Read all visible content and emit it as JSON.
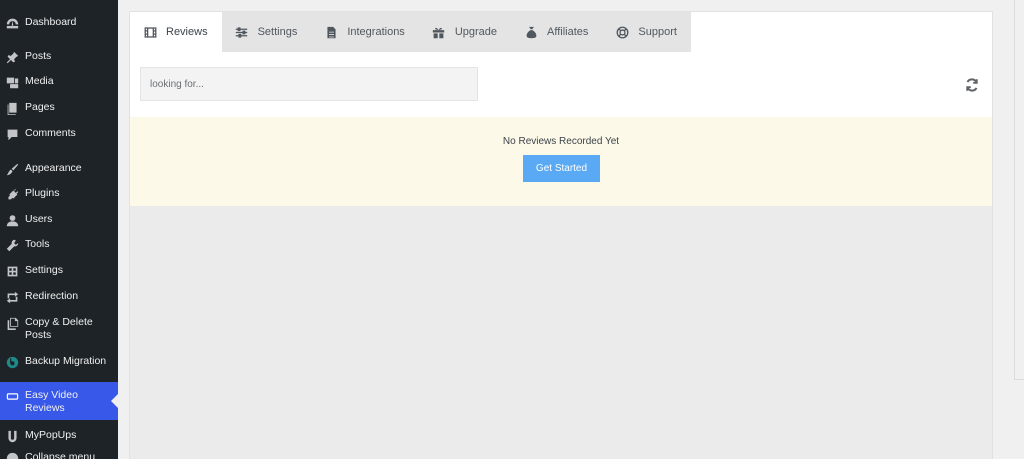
{
  "sidebar": {
    "items": [
      {
        "label": "Dashboard",
        "icon": "dashboard-icon"
      },
      {
        "label": "Posts",
        "icon": "pin-icon"
      },
      {
        "label": "Media",
        "icon": "media-icon"
      },
      {
        "label": "Pages",
        "icon": "pages-icon"
      },
      {
        "label": "Comments",
        "icon": "comment-icon"
      },
      {
        "label": "Appearance",
        "icon": "brush-icon"
      },
      {
        "label": "Plugins",
        "icon": "plug-icon"
      },
      {
        "label": "Users",
        "icon": "user-icon"
      },
      {
        "label": "Tools",
        "icon": "wrench-icon"
      },
      {
        "label": "Settings",
        "icon": "settings-icon"
      },
      {
        "label": "Redirection",
        "icon": "redirect-icon"
      },
      {
        "label": "Copy & Delete Posts",
        "icon": "copy-icon"
      },
      {
        "label": "Backup Migration",
        "icon": "backup-icon"
      },
      {
        "label": "Easy Video Reviews",
        "icon": "video-review-icon"
      },
      {
        "label": "MyPopUps",
        "icon": "popup-icon"
      },
      {
        "label": "Collapse menu",
        "icon": "collapse-icon"
      }
    ],
    "active_label": "Easy Video Reviews"
  },
  "tabs": [
    {
      "label": "Reviews",
      "icon": "film-icon"
    },
    {
      "label": "Settings",
      "icon": "sliders-icon"
    },
    {
      "label": "Integrations",
      "icon": "document-icon"
    },
    {
      "label": "Upgrade",
      "icon": "gift-icon"
    },
    {
      "label": "Affiliates",
      "icon": "money-bag-icon"
    },
    {
      "label": "Support",
      "icon": "lifebuoy-icon"
    }
  ],
  "active_tab": "Reviews",
  "search": {
    "placeholder": "looking for...",
    "value": ""
  },
  "notice": {
    "message": "No Reviews Recorded Yet",
    "button_label": "Get Started"
  },
  "colors": {
    "sidebar_bg": "#1d2327",
    "active_menu": "#3858e9",
    "notice_bg": "#fcf9e8",
    "button_bg": "#5aa9f4"
  }
}
